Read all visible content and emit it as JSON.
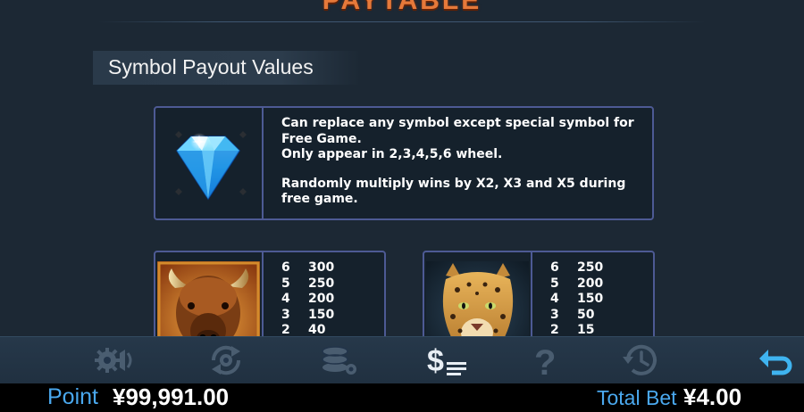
{
  "header": {
    "title": "PAYTABLE"
  },
  "section": {
    "title": "Symbol Payout Values"
  },
  "wild": {
    "icon": "diamond-icon",
    "description_1": "Can replace any symbol except special symbol for Free Game.",
    "description_2": "Only appear in 2,3,4,5,6 wheel.",
    "description_3": "Randomly multiply wins by X2, X3 and X5 during free game."
  },
  "paytables": [
    {
      "symbol": "buffalo",
      "rows": [
        {
          "count": "6",
          "value": "300"
        },
        {
          "count": "5",
          "value": "250"
        },
        {
          "count": "4",
          "value": "200"
        },
        {
          "count": "3",
          "value": "150"
        },
        {
          "count": "2",
          "value": "40"
        }
      ]
    },
    {
      "symbol": "leopard",
      "rows": [
        {
          "count": "6",
          "value": "250"
        },
        {
          "count": "5",
          "value": "200"
        },
        {
          "count": "4",
          "value": "150"
        },
        {
          "count": "3",
          "value": "50"
        },
        {
          "count": "2",
          "value": "15"
        }
      ]
    }
  ],
  "toolbar": {
    "buttons": [
      "sound-settings-icon",
      "autoplay-settings-icon",
      "bet-settings-icon",
      "paytable-icon",
      "help-icon",
      "history-icon",
      "back-icon"
    ],
    "active": "paytable-icon",
    "colors": {
      "inactive": "#4a5d70",
      "active": "#e8eef4",
      "back": "#3fb4f0"
    }
  },
  "status": {
    "point_label": "Point",
    "point_value": "¥99,991.00",
    "bet_label": "Total Bet",
    "bet_value": "¥4.00"
  }
}
